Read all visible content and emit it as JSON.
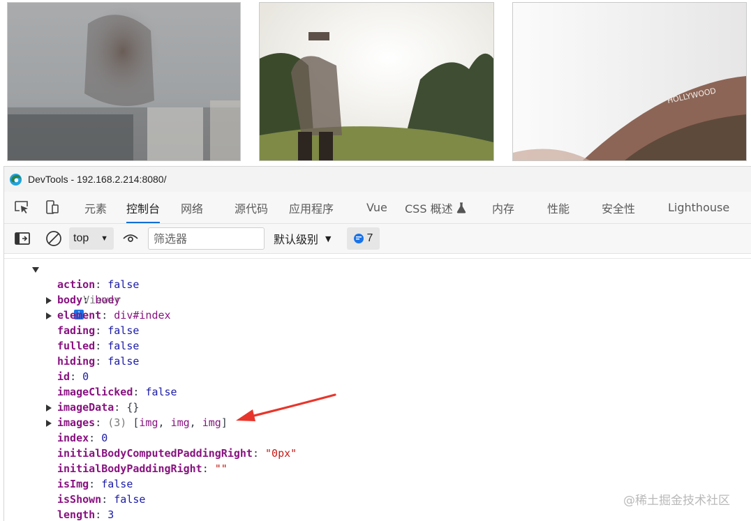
{
  "window": {
    "title": "DevTools - 192.168.2.214:8080/"
  },
  "tabs": [
    {
      "label": "元素"
    },
    {
      "label": "控制台",
      "active": true
    },
    {
      "label": "网络"
    },
    {
      "label": "源代码"
    },
    {
      "label": "应用程序"
    },
    {
      "label": "Vue"
    },
    {
      "label": "CSS 概述"
    },
    {
      "label": "内存"
    },
    {
      "label": "性能"
    },
    {
      "label": "安全性"
    },
    {
      "label": "Lighthouse"
    }
  ],
  "toolbar": {
    "context": "top",
    "filter_placeholder": "筛选器",
    "level": "默认级别",
    "message_count": "7"
  },
  "console": {
    "object_name": "Viewer",
    "info_badge": "i",
    "props": [
      {
        "key": "action",
        "value": "false",
        "kind": "bool"
      },
      {
        "key": "body",
        "value": "body",
        "kind": "node",
        "expandable": true
      },
      {
        "key": "element",
        "value": "div#index",
        "kind": "node",
        "expandable": true
      },
      {
        "key": "fading",
        "value": "false",
        "kind": "bool"
      },
      {
        "key": "fulled",
        "value": "false",
        "kind": "bool"
      },
      {
        "key": "hiding",
        "value": "false",
        "kind": "bool"
      },
      {
        "key": "id",
        "value": "0",
        "kind": "num"
      },
      {
        "key": "imageClicked",
        "value": "false",
        "kind": "bool"
      },
      {
        "key": "imageData",
        "value": "{}",
        "kind": "plain",
        "expandable": true
      },
      {
        "key": "images",
        "value_prefix": "(3) ",
        "value": "[img, img, img]",
        "kind": "array",
        "expandable": true
      },
      {
        "key": "index",
        "value": "0",
        "kind": "num"
      },
      {
        "key": "initialBodyComputedPaddingRight",
        "value": "\"0px\"",
        "kind": "str"
      },
      {
        "key": "initialBodyPaddingRight",
        "value": "\"\"",
        "kind": "str"
      },
      {
        "key": "isImg",
        "value": "false",
        "kind": "bool"
      },
      {
        "key": "isShown",
        "value": "false",
        "kind": "bool"
      },
      {
        "key": "length",
        "value": "3",
        "kind": "num"
      }
    ]
  },
  "watermark": "@稀土掘金技术社区",
  "colors": {
    "accent": "#0b6fd6",
    "key": "#881280",
    "keyword": "#1a1aa6",
    "string": "#c41a16",
    "arrow": "#e8352b"
  }
}
